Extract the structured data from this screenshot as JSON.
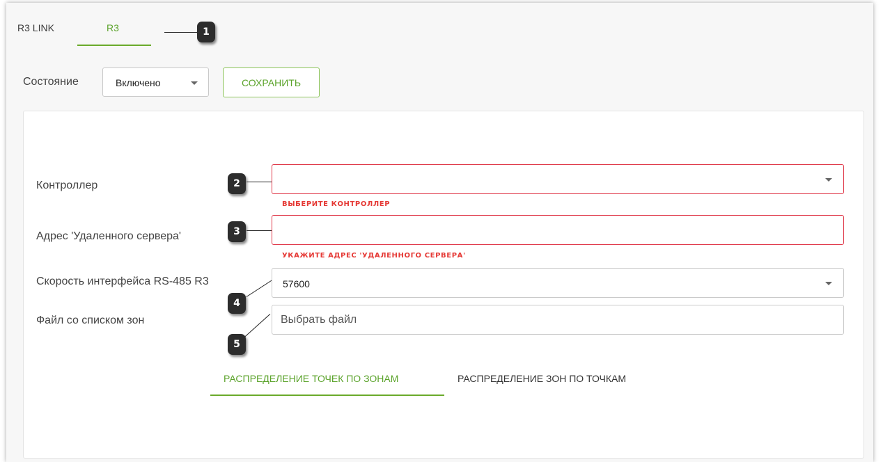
{
  "tabs": [
    {
      "label": "R3 LINK",
      "active": false
    },
    {
      "label": "R3",
      "active": true
    }
  ],
  "callouts": [
    "1",
    "2",
    "3",
    "4",
    "5"
  ],
  "state": {
    "label": "Состояние",
    "value": "Включено"
  },
  "toolbar": {
    "save_label": "СОХРАНИТЬ"
  },
  "form": {
    "controller": {
      "label": "Контроллер",
      "value": "",
      "error": "ВЫБЕРИТЕ КОНТРОЛЛЕР"
    },
    "server_address": {
      "label": "Адрес 'Удаленного сервера'",
      "value": "",
      "error": "УКАЖИТЕ АДРЕС 'УДАЛЕННОГО СЕРВЕРА'"
    },
    "rs485_speed": {
      "label": "Скорость интерфейса RS-485 R3",
      "value": "57600"
    },
    "zones_file": {
      "label": "Файл со списком зон",
      "placeholder": "Выбрать файл"
    }
  },
  "sub_tabs": [
    {
      "label": "РАСПРЕДЕЛЕНИЕ ТОЧЕК ПО ЗОНАМ",
      "active": true
    },
    {
      "label": "РАСПРЕДЕЛЕНИЕ ЗОН ПО ТОЧКАМ",
      "active": false
    }
  ],
  "colors": {
    "accent": "#6aaa2a",
    "error": "#e53935",
    "badge": "#2d2d2d"
  }
}
